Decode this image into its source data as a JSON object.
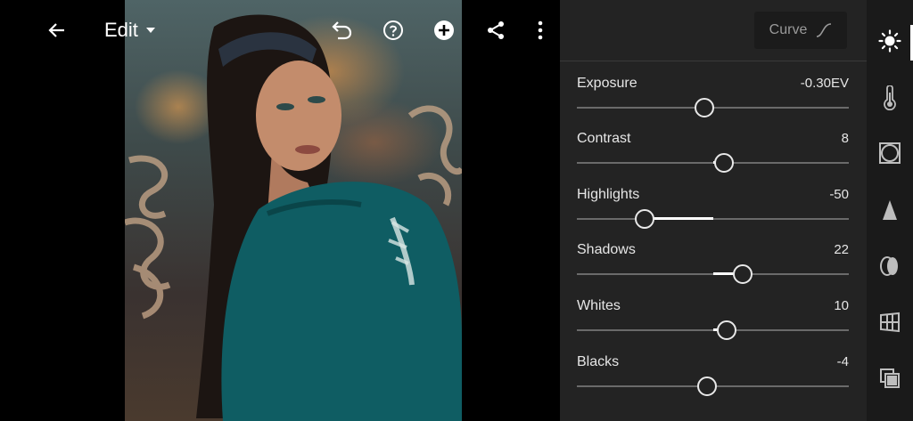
{
  "topbar": {
    "edit_label": "Edit",
    "icons": [
      "back-arrow-icon",
      "undo-icon",
      "help-icon",
      "add-icon",
      "share-icon",
      "more-vertical-icon"
    ]
  },
  "panel": {
    "curve_label": "Curve",
    "sliders": [
      {
        "name": "Exposure",
        "value": "-0.30EV",
        "numeric": -0.3,
        "min": -5,
        "max": 5
      },
      {
        "name": "Contrast",
        "value": "8",
        "numeric": 8,
        "min": -100,
        "max": 100
      },
      {
        "name": "Highlights",
        "value": "-50",
        "numeric": -50,
        "min": -100,
        "max": 100
      },
      {
        "name": "Shadows",
        "value": "22",
        "numeric": 22,
        "min": -100,
        "max": 100
      },
      {
        "name": "Whites",
        "value": "10",
        "numeric": 10,
        "min": -100,
        "max": 100
      },
      {
        "name": "Blacks",
        "value": "-4",
        "numeric": -4,
        "min": -100,
        "max": 100
      }
    ]
  },
  "rail": {
    "tools": [
      "light-icon",
      "color-temperature-icon",
      "effects-icon",
      "detail-icon",
      "optics-icon",
      "geometry-icon",
      "presets-icon"
    ],
    "active": "light-icon"
  },
  "colors": {
    "panel_bg": "#232323",
    "rail_bg": "#1a1a1a",
    "accent": "#ffffff",
    "track": "#6a6a6a"
  }
}
